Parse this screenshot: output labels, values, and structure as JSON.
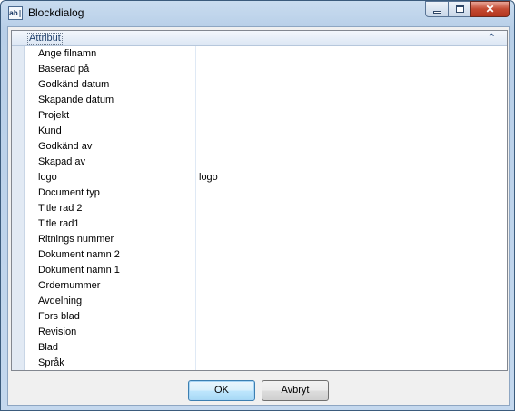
{
  "window": {
    "title": "Blockdialog",
    "icon": "text-field-icon",
    "icon_glyph": "ab|",
    "minimize_glyph": "",
    "maximize_glyph": "",
    "close_glyph": "✕"
  },
  "grid": {
    "category": "Attribut",
    "collapse_glyph": "⌃",
    "rows": [
      {
        "name": "Ange filnamn",
        "value": ""
      },
      {
        "name": "Baserad på",
        "value": ""
      },
      {
        "name": "Godkänd datum",
        "value": ""
      },
      {
        "name": "Skapande datum",
        "value": ""
      },
      {
        "name": "Projekt",
        "value": ""
      },
      {
        "name": "Kund",
        "value": ""
      },
      {
        "name": "Godkänd av",
        "value": ""
      },
      {
        "name": "Skapad av",
        "value": ""
      },
      {
        "name": "logo",
        "value": "logo"
      },
      {
        "name": "Document typ",
        "value": ""
      },
      {
        "name": "Title rad 2",
        "value": ""
      },
      {
        "name": "Title rad1",
        "value": ""
      },
      {
        "name": "Ritnings nummer",
        "value": ""
      },
      {
        "name": "Dokument namn 2",
        "value": ""
      },
      {
        "name": "Dokument namn 1",
        "value": ""
      },
      {
        "name": "Ordernummer",
        "value": ""
      },
      {
        "name": "Avdelning",
        "value": ""
      },
      {
        "name": "Fors blad",
        "value": ""
      },
      {
        "name": "Revision",
        "value": ""
      },
      {
        "name": "Blad",
        "value": ""
      },
      {
        "name": "Språk",
        "value": ""
      }
    ]
  },
  "buttons": {
    "ok": "OK",
    "cancel": "Avbryt"
  }
}
